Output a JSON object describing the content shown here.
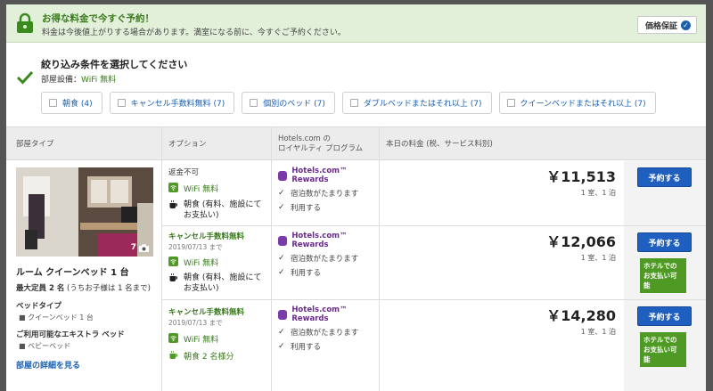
{
  "promo": {
    "title": "お得な料金で今すぐ予約！",
    "subtitle": "料金は今後値上がりする場合があります。満室になる前に、今すぐご予約ください。",
    "guarantee_label": "価格保証",
    "guarantee_icon": "check-circle-icon"
  },
  "filters": {
    "title": "絞り込み条件を選択してください",
    "amenity_prefix": "部屋設備：",
    "amenity_value": "WiFi 無料",
    "chips": [
      {
        "label": "朝食 (4)"
      },
      {
        "label": "キャンセル手数料無料 (7)"
      },
      {
        "label": "個別のベッド (7)"
      },
      {
        "label": "ダブルベッドまたはそれ以上 (7)"
      },
      {
        "label": "クイーンベッドまたはそれ以上 (7)"
      }
    ]
  },
  "table": {
    "headers": {
      "room_type": "部屋タイプ",
      "options": "オプション",
      "loyalty_line1": "Hotels.com の",
      "loyalty_line2": "ロイヤルティ プログラム",
      "price": "本日の料金 (税、サービス料別)"
    }
  },
  "room": {
    "photo_count": "7",
    "name": "ルーム クイーンベッド 1 台",
    "occupancy_bold": "最大定員 2 名",
    "occupancy_rest": " (うちお子様は 1 名まで)",
    "bed_heading": "ベッドタイプ",
    "bed_value": "クイーンベッド 1 台",
    "extra_heading": "ご利用可能なエキストラ ベッド",
    "extra_value": "ベビーベッド",
    "details_link": "部屋の詳細を見る"
  },
  "rows": [
    {
      "cancel": "返金不可",
      "until": "",
      "wifi": "WiFi 無料",
      "meal": "朝食 (有料、施設にてお支払い)",
      "loyalty_brand": "Hotels.com™ Rewards",
      "loyalty_items": [
        "宿泊数がたまります",
        "利用する"
      ],
      "price": "￥11,513",
      "price_unit": "1 室、1 泊",
      "book_label": "予約する",
      "pay_at_hotel": ""
    },
    {
      "cancel": "キャンセル手数料無料",
      "until": "2019/07/13 まで",
      "wifi": "WiFi 無料",
      "meal": "朝食 (有料、施設にてお支払い)",
      "loyalty_brand": "Hotels.com™ Rewards",
      "loyalty_items": [
        "宿泊数がたまります",
        "利用する"
      ],
      "price": "￥12,066",
      "price_unit": "1 室、1 泊",
      "book_label": "予約する",
      "pay_at_hotel": "ホテルでのお支払い可能"
    },
    {
      "cancel": "キャンセル手数料無料",
      "until": "2019/07/13 まで",
      "wifi": "WiFi 無料",
      "meal": "朝食 2 名様分",
      "loyalty_brand": "Hotels.com™ Rewards",
      "loyalty_items": [
        "宿泊数がたまります",
        "利用する"
      ],
      "price": "￥14,280",
      "price_unit": "1 室、1 泊",
      "book_label": "予約する",
      "pay_at_hotel": "ホテルでのお支払い可能"
    }
  ],
  "colors": {
    "green": "#3a7a1e",
    "banner_bg": "#e2efd9",
    "link_blue": "#1b5fae",
    "button_blue": "#1f5fbf",
    "rewards_purple": "#7c3aa8",
    "pay_badge_green": "#4f9a24"
  }
}
